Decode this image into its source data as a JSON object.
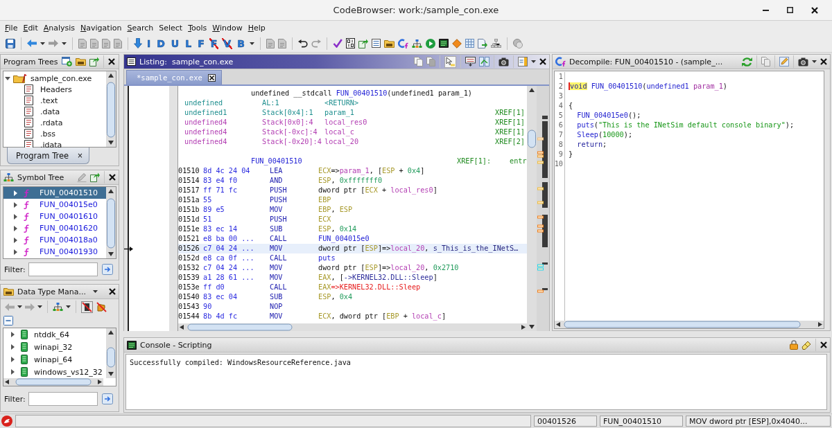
{
  "window": {
    "title": "CodeBrowser: work:/sample_con.exe"
  },
  "menu": [
    {
      "label": "File",
      "underlined": true
    },
    {
      "label": "Edit",
      "underlined": true
    },
    {
      "label": "Analysis",
      "underlined": true
    },
    {
      "label": "Navigation",
      "underlined": true
    },
    {
      "label": "Search",
      "underlined": true
    },
    {
      "label": "Select",
      "underlined": false
    },
    {
      "label": "Tools",
      "underlined": true
    },
    {
      "label": "Window",
      "underlined": true
    },
    {
      "label": "Help",
      "underlined": true
    }
  ],
  "toolbar": {
    "letter_buttons": [
      {
        "label": "I",
        "crossed": false
      },
      {
        "label": "D",
        "crossed": false
      },
      {
        "label": "U",
        "crossed": false
      },
      {
        "label": "L",
        "crossed": false
      },
      {
        "label": "F",
        "crossed": false
      },
      {
        "label": "F",
        "crossed": true
      },
      {
        "label": "V",
        "crossed": true
      },
      {
        "label": "B",
        "crossed": false
      }
    ]
  },
  "program_trees": {
    "title": "Program Trees",
    "active": false,
    "root": {
      "label": "sample_con.exe",
      "expanded": true,
      "children": [
        {
          "label": "Headers"
        },
        {
          "label": ".text"
        },
        {
          "label": ".data"
        },
        {
          "label": ".rdata"
        },
        {
          "label": ".bss"
        },
        {
          "label": ".idata"
        }
      ]
    },
    "tab": {
      "label": "Program Tree",
      "close": "×"
    }
  },
  "symbol_tree": {
    "title": "Symbol Tree",
    "active": false,
    "items": [
      {
        "label": "FUN_00401510",
        "expanded": false,
        "selected": true
      },
      {
        "label": "FUN_004015e0",
        "expanded": false,
        "selected": false
      },
      {
        "label": "FUN_00401610",
        "expanded": false,
        "selected": false
      },
      {
        "label": "FUN_00401620",
        "expanded": false,
        "selected": false
      },
      {
        "label": "FUN_004018a0",
        "expanded": false,
        "selected": false
      },
      {
        "label": "FUN_00401930",
        "expanded": false,
        "selected": false
      }
    ],
    "filter": {
      "label": "Filter:"
    }
  },
  "data_type_manager": {
    "title": "Data Type Mana...",
    "active": false,
    "items": [
      {
        "label": "ntddk_64",
        "expanded": false
      },
      {
        "label": "winapi_32",
        "expanded": false
      },
      {
        "label": "winapi_64",
        "expanded": false
      },
      {
        "label": "windows_vs12_32",
        "expanded": false
      }
    ],
    "filter": {
      "label": "Filter:"
    }
  },
  "listing": {
    "title": "Listing:  sample_con.exe",
    "active": true,
    "tab": {
      "label": "*sample_con.exe"
    },
    "signature": [
      {
        "text": "undefined __stdcall ",
        "kind": "plain"
      },
      {
        "text": "FUN_00401510",
        "kind": "function"
      },
      {
        "text": "(undefined1 param_1)",
        "kind": "plain"
      }
    ],
    "variables": [
      {
        "type": "undefined",
        "storage": "AL:1",
        "name": "<RETURN>",
        "kind": "return"
      },
      {
        "type": "undefined1",
        "storage": "Stack[0x4]:1",
        "name": "param_1",
        "xref": "XREF[1]",
        "kind": "param"
      },
      {
        "type": "undefined4",
        "storage": "Stack[0x0]:4",
        "name": "local_res0",
        "xref": "XREF[1]",
        "kind": "local"
      },
      {
        "type": "undefined4",
        "storage": "Stack[-0xc]:4",
        "name": "local_c",
        "xref": "XREF[1]",
        "kind": "local"
      },
      {
        "type": "undefined4",
        "storage": "Stack[-0x20]:4",
        "name": "local_20",
        "xref": "XREF[2]",
        "kind": "local"
      }
    ],
    "label": {
      "name": "FUN_00401510",
      "xref": "XREF[1]:",
      "source": "entr"
    },
    "instructions": [
      {
        "address": "01510",
        "bytes": "8d 4c 24 04",
        "mnemonic": "LEA",
        "operands": [
          {
            "text": "ECX",
            "kind": "register"
          },
          {
            "text": "=>",
            "kind": "plain"
          },
          {
            "text": "param_1",
            "kind": "variable"
          },
          {
            "text": ", [",
            "kind": "plain"
          },
          {
            "text": "ESP",
            "kind": "register"
          },
          {
            "text": " + ",
            "kind": "plain"
          },
          {
            "text": "0x4",
            "kind": "number"
          },
          {
            "text": "]",
            "kind": "plain"
          }
        ],
        "selected": false
      },
      {
        "address": "01514",
        "bytes": "83 e4 f0",
        "mnemonic": "AND",
        "operands": [
          {
            "text": "ESP",
            "kind": "register"
          },
          {
            "text": ", ",
            "kind": "plain"
          },
          {
            "text": "0xfffffff0",
            "kind": "number"
          }
        ],
        "selected": false
      },
      {
        "address": "01517",
        "bytes": "ff 71 fc",
        "mnemonic": "PUSH",
        "operands": [
          {
            "text": "dword ptr [",
            "kind": "plain"
          },
          {
            "text": "ECX",
            "kind": "register"
          },
          {
            "text": " + ",
            "kind": "plain"
          },
          {
            "text": "local_res0",
            "kind": "variable"
          },
          {
            "text": "]",
            "kind": "plain"
          }
        ],
        "selected": false
      },
      {
        "address": "0151a",
        "bytes": "55",
        "mnemonic": "PUSH",
        "operands": [
          {
            "text": "EBP",
            "kind": "register"
          }
        ],
        "selected": false
      },
      {
        "address": "0151b",
        "bytes": "89 e5",
        "mnemonic": "MOV",
        "operands": [
          {
            "text": "EBP",
            "kind": "register"
          },
          {
            "text": ", ",
            "kind": "plain"
          },
          {
            "text": "ESP",
            "kind": "register"
          }
        ],
        "selected": false
      },
      {
        "address": "0151d",
        "bytes": "51",
        "mnemonic": "PUSH",
        "operands": [
          {
            "text": "ECX",
            "kind": "register"
          }
        ],
        "selected": false
      },
      {
        "address": "0151e",
        "bytes": "83 ec 14",
        "mnemonic": "SUB",
        "operands": [
          {
            "text": "ESP",
            "kind": "register"
          },
          {
            "text": ", ",
            "kind": "plain"
          },
          {
            "text": "0x14",
            "kind": "number"
          }
        ],
        "selected": false
      },
      {
        "address": "01521",
        "bytes": "e8 ba 00 ...",
        "mnemonic": "CALL",
        "operands": [
          {
            "text": "FUN_004015e0",
            "kind": "function"
          }
        ],
        "selected": false
      },
      {
        "address": "01526",
        "bytes": "c7 04 24 ...",
        "mnemonic": "MOV",
        "operands": [
          {
            "text": "dword ptr [",
            "kind": "plain"
          },
          {
            "text": "ESP",
            "kind": "register"
          },
          {
            "text": "]=>",
            "kind": "plain"
          },
          {
            "text": "local_20",
            "kind": "variable"
          },
          {
            "text": ", ",
            "kind": "plain"
          },
          {
            "text": "s_This_is_the_INetS…",
            "kind": "label"
          }
        ],
        "selected": true
      },
      {
        "address": "0152d",
        "bytes": "e8 ca 0f ...",
        "mnemonic": "CALL",
        "operands": [
          {
            "text": "puts",
            "kind": "function"
          }
        ],
        "selected": false
      },
      {
        "address": "01532",
        "bytes": "c7 04 24 ...",
        "mnemonic": "MOV",
        "operands": [
          {
            "text": "dword ptr [",
            "kind": "plain"
          },
          {
            "text": "ESP",
            "kind": "register"
          },
          {
            "text": "]=>",
            "kind": "plain"
          },
          {
            "text": "local_20",
            "kind": "variable"
          },
          {
            "text": ", ",
            "kind": "plain"
          },
          {
            "text": "0x2710",
            "kind": "number"
          }
        ],
        "selected": false
      },
      {
        "address": "01539",
        "bytes": "a1 28 61 ...",
        "mnemonic": "MOV",
        "operands": [
          {
            "text": "EAX",
            "kind": "register"
          },
          {
            "text": ", [",
            "kind": "plain"
          },
          {
            "text": "->KERNEL32.DLL::Sleep",
            "kind": "pointer"
          },
          {
            "text": "]",
            "kind": "plain"
          }
        ],
        "selected": false
      },
      {
        "address": "0153e",
        "bytes": "ff d0",
        "mnemonic": "CALL",
        "operands": [
          {
            "text": "EAX",
            "kind": "register"
          },
          {
            "text": "=>KERNEL32.DLL::Sleep",
            "kind": "import"
          }
        ],
        "selected": false
      },
      {
        "address": "01540",
        "bytes": "83 ec 04",
        "mnemonic": "SUB",
        "operands": [
          {
            "text": "ESP",
            "kind": "register"
          },
          {
            "text": ", ",
            "kind": "plain"
          },
          {
            "text": "0x4",
            "kind": "number"
          }
        ],
        "selected": false
      },
      {
        "address": "01543",
        "bytes": "90",
        "mnemonic": "NOP",
        "selected": false
      },
      {
        "address": "01544",
        "bytes": "8b 4d fc",
        "mnemonic": "MOV",
        "operands": [
          {
            "text": "ECX",
            "kind": "register"
          },
          {
            "text": ", dword ptr [",
            "kind": "plain"
          },
          {
            "text": "EBP",
            "kind": "register"
          },
          {
            "text": " + ",
            "kind": "plain"
          },
          {
            "text": "local_c",
            "kind": "variable"
          },
          {
            "text": "]",
            "kind": "plain"
          }
        ],
        "selected": false
      }
    ]
  },
  "decompiler": {
    "title": "Decompile: FUN_00401510 - (sample_...",
    "active": false,
    "lines": [
      {
        "number": "1"
      },
      {
        "number": "2",
        "tokens": [
          {
            "text": "void",
            "kind": "keyword",
            "highlighted": true
          },
          {
            "text": " FUN_00401510",
            "kind": "function",
            "highlighted": false
          },
          {
            "text": "(",
            "kind": "plain",
            "highlighted": false
          },
          {
            "text": "undefined1",
            "kind": "type",
            "highlighted": false
          },
          {
            "text": " param_1",
            "kind": "variable",
            "highlighted": false
          },
          {
            "text": ")",
            "kind": "plain",
            "highlighted": false
          }
        ]
      },
      {
        "number": "3"
      },
      {
        "number": "4",
        "tokens": [
          {
            "text": "{",
            "kind": "plain",
            "highlighted": false
          }
        ]
      },
      {
        "number": "5",
        "tokens": [
          {
            "text": "  FUN_004015e0",
            "kind": "function",
            "highlighted": false
          },
          {
            "text": "();",
            "kind": "plain",
            "highlighted": false
          }
        ]
      },
      {
        "number": "6",
        "tokens": [
          {
            "text": "  puts",
            "kind": "function",
            "highlighted": false
          },
          {
            "text": "(",
            "kind": "plain",
            "highlighted": false
          },
          {
            "text": "\"This is the INetSim default console binary\"",
            "kind": "string",
            "highlighted": false
          },
          {
            "text": ");",
            "kind": "plain",
            "highlighted": false
          }
        ]
      },
      {
        "number": "7",
        "tokens": [
          {
            "text": "  Sleep",
            "kind": "function",
            "highlighted": false
          },
          {
            "text": "(",
            "kind": "plain",
            "highlighted": false
          },
          {
            "text": "10000",
            "kind": "number",
            "highlighted": false
          },
          {
            "text": ");",
            "kind": "plain",
            "highlighted": false
          }
        ]
      },
      {
        "number": "8",
        "tokens": [
          {
            "text": "  return",
            "kind": "keyword",
            "highlighted": false
          },
          {
            "text": ";",
            "kind": "plain",
            "highlighted": false
          }
        ]
      },
      {
        "number": "9",
        "tokens": [
          {
            "text": "}",
            "kind": "plain",
            "highlighted": false
          }
        ]
      },
      {
        "number": "10"
      }
    ]
  },
  "console": {
    "title": "Console - Scripting",
    "active": false,
    "text": "Successfully compiled: WindowsResourceReference.java"
  },
  "status_bar": {
    "fields": [
      "00401526",
      "FUN_00401510",
      "MOV dword ptr [ESP],0x4040..."
    ]
  }
}
